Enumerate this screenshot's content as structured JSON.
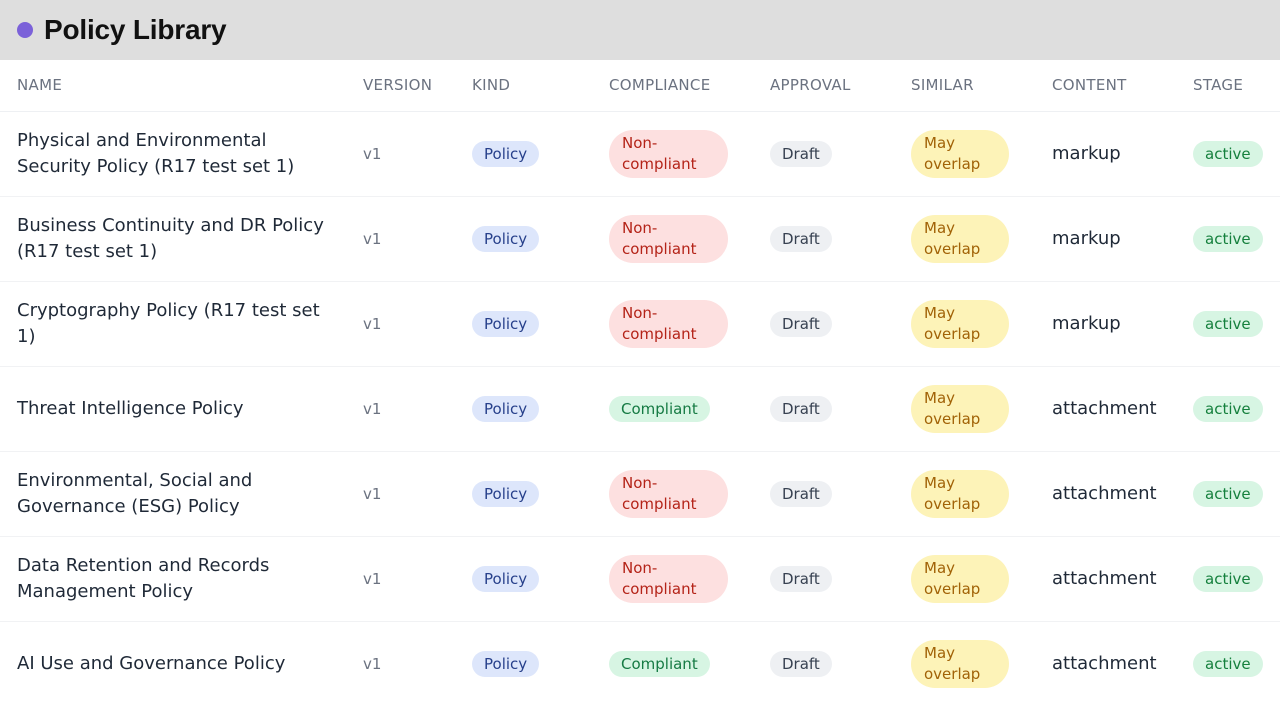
{
  "header": {
    "title": "Policy Library"
  },
  "table": {
    "columns": [
      "NAME",
      "VERSION",
      "KIND",
      "COMPLIANCE",
      "APPROVAL",
      "SIMILAR",
      "CONTENT",
      "STAGE"
    ],
    "rows": [
      {
        "name": "Physical and Environmental Security Policy (R17 test set 1)",
        "version": "v1",
        "kind": "Policy",
        "compliance": "Non-compliant",
        "approval": "Draft",
        "similar": "May overlap",
        "content": "markup",
        "stage": "active"
      },
      {
        "name": "Business Continuity and DR Policy (R17 test set 1)",
        "version": "v1",
        "kind": "Policy",
        "compliance": "Non-compliant",
        "approval": "Draft",
        "similar": "May overlap",
        "content": "markup",
        "stage": "active"
      },
      {
        "name": "Cryptography Policy (R17 test set 1)",
        "version": "v1",
        "kind": "Policy",
        "compliance": "Non-compliant",
        "approval": "Draft",
        "similar": "May overlap",
        "content": "markup",
        "stage": "active"
      },
      {
        "name": "Threat Intelligence Policy",
        "version": "v1",
        "kind": "Policy",
        "compliance": "Compliant",
        "approval": "Draft",
        "similar": "May overlap",
        "content": "attachment",
        "stage": "active"
      },
      {
        "name": "Environmental, Social and Governance (ESG) Policy",
        "version": "v1",
        "kind": "Policy",
        "compliance": "Non-compliant",
        "approval": "Draft",
        "similar": "May overlap",
        "content": "attachment",
        "stage": "active"
      },
      {
        "name": "Data Retention and Records Management Policy",
        "version": "v1",
        "kind": "Policy",
        "compliance": "Non-compliant",
        "approval": "Draft",
        "similar": "May overlap",
        "content": "attachment",
        "stage": "active"
      },
      {
        "name": "AI Use and Governance Policy",
        "version": "v1",
        "kind": "Policy",
        "compliance": "Compliant",
        "approval": "Draft",
        "similar": "May overlap",
        "content": "attachment",
        "stage": "active"
      }
    ]
  },
  "colors": {
    "accent_dot": "#7b61d9",
    "non_compliant_bg": "#fde0e0",
    "compliant_bg": "#d7f5e3",
    "similar_bg": "#fdf3b8"
  }
}
